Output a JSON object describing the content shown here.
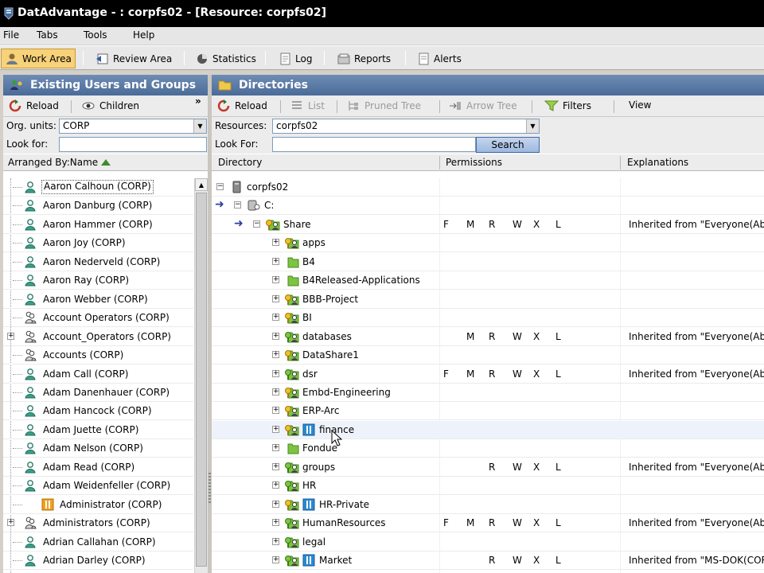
{
  "window": {
    "title": "DatAdvantage - : corpfs02 - [Resource: corpfs02]"
  },
  "menubar": {
    "items": [
      "File",
      "Tabs",
      "Tools",
      "Help"
    ]
  },
  "toolbar": {
    "work_area": "Work Area",
    "review_area": "Review Area",
    "statistics": "Statistics",
    "log": "Log",
    "reports": "Reports",
    "alerts": "Alerts"
  },
  "left": {
    "header": "Existing Users and Groups",
    "reload": "Reload",
    "children": "Children",
    "more": "»",
    "org_units_label": "Org. units:",
    "org_units_value": "CORP",
    "look_for_label": "Look for:",
    "look_for_value": "",
    "arranged_by": "Arranged By:Name",
    "users": [
      {
        "name": "Aaron Calhoun (CORP)",
        "type": "user",
        "expandable": false,
        "selected": true
      },
      {
        "name": "Aaron Danburg (CORP)",
        "type": "user",
        "expandable": false
      },
      {
        "name": "Aaron Hammer (CORP)",
        "type": "user",
        "expandable": false
      },
      {
        "name": "Aaron Joy (CORP)",
        "type": "user",
        "expandable": false
      },
      {
        "name": "Aaron Nederveld (CORP)",
        "type": "user",
        "expandable": false
      },
      {
        "name": "Aaron Ray (CORP)",
        "type": "user",
        "expandable": false
      },
      {
        "name": "Aaron Webber (CORP)",
        "type": "user",
        "expandable": false
      },
      {
        "name": "Account Operators (CORP)",
        "type": "group",
        "expandable": false
      },
      {
        "name": "Account_Operators (CORP)",
        "type": "group",
        "expandable": true
      },
      {
        "name": "Accounts (CORP)",
        "type": "group",
        "expandable": false
      },
      {
        "name": "Adam Call (CORP)",
        "type": "user",
        "expandable": false
      },
      {
        "name": "Adam Danenhauer (CORP)",
        "type": "user",
        "expandable": false
      },
      {
        "name": "Adam Hancock (CORP)",
        "type": "user",
        "expandable": false
      },
      {
        "name": "Adam Juette (CORP)",
        "type": "user",
        "expandable": false
      },
      {
        "name": "Adam Nelson (CORP)",
        "type": "user",
        "expandable": false
      },
      {
        "name": "Adam Read (CORP)",
        "type": "user",
        "expandable": false
      },
      {
        "name": "Adam Weidenfeller (CORP)",
        "type": "user",
        "expandable": false
      },
      {
        "name": "Administrator (CORP)",
        "type": "admin",
        "expandable": false
      },
      {
        "name": "Administrators (CORP)",
        "type": "group",
        "expandable": true
      },
      {
        "name": "Adrian Callahan (CORP)",
        "type": "user",
        "expandable": false
      },
      {
        "name": "Adrian Darley (CORP)",
        "type": "user",
        "expandable": false
      }
    ]
  },
  "right": {
    "header": "Directories",
    "reload": "Reload",
    "list": "List",
    "pruned_tree": "Pruned Tree",
    "arrow_tree": "Arrow Tree",
    "filters": "Filters",
    "view": "View",
    "resources_label": "Resources:",
    "resources_value": "corpfs02",
    "look_for_label": "Look For:",
    "look_for_value": "",
    "search_button": "Search",
    "columns": [
      "Directory",
      "Permissions",
      "Explanations"
    ],
    "rows": [
      {
        "name": "corpfs02",
        "level": 0,
        "icon": "server",
        "expander": "-",
        "perms": [],
        "expl": ""
      },
      {
        "name": "C:",
        "level": 1,
        "icon": "drive",
        "expander": "-",
        "arrow": true,
        "perms": [],
        "expl": ""
      },
      {
        "name": "Share",
        "level": 2,
        "icon": "share-folder",
        "expander": "-",
        "arrow": true,
        "perms": [
          "F",
          "M",
          "R",
          "W",
          "X",
          "L"
        ],
        "expl": "Inherited from \"Everyone(Abstr"
      },
      {
        "name": "apps",
        "level": 3,
        "icon": "folder-unique",
        "expander": "+",
        "perms": [],
        "expl": ""
      },
      {
        "name": "B4",
        "level": 3,
        "icon": "folder",
        "expander": "+",
        "perms": [],
        "expl": ""
      },
      {
        "name": "B4Released-Applications",
        "level": 3,
        "icon": "folder",
        "expander": "+",
        "perms": [],
        "expl": ""
      },
      {
        "name": "BBB-Project",
        "level": 3,
        "icon": "folder-unique",
        "expander": "+",
        "perms": [],
        "expl": ""
      },
      {
        "name": "BI",
        "level": 3,
        "icon": "folder-unique",
        "expander": "+",
        "perms": [],
        "expl": ""
      },
      {
        "name": "databases",
        "level": 3,
        "icon": "folder-perm",
        "expander": "+",
        "perms": [
          "",
          "M",
          "R",
          "W",
          "X",
          "L"
        ],
        "expl": "Inherited from \"Everyone(Abstr"
      },
      {
        "name": "DataShare1",
        "level": 3,
        "icon": "folder-unique",
        "expander": "+",
        "perms": [],
        "expl": ""
      },
      {
        "name": "dsr",
        "level": 3,
        "icon": "folder-perm",
        "expander": "+",
        "perms": [
          "F",
          "M",
          "R",
          "W",
          "X",
          "L"
        ],
        "expl": "Inherited from \"Everyone(Abstr"
      },
      {
        "name": "Embd-Engineering",
        "level": 3,
        "icon": "folder-unique",
        "expander": "+",
        "perms": [],
        "expl": ""
      },
      {
        "name": "ERP-Arc",
        "level": 3,
        "icon": "folder-unique",
        "expander": "+",
        "perms": [],
        "expl": ""
      },
      {
        "name": "finance",
        "level": 3,
        "icon": "folder-unique-tagged",
        "expander": "+",
        "perms": [],
        "expl": "",
        "hover": true
      },
      {
        "name": "Fondue",
        "level": 3,
        "icon": "folder",
        "expander": "+",
        "perms": [],
        "expl": ""
      },
      {
        "name": "groups",
        "level": 3,
        "icon": "folder-perm",
        "expander": "+",
        "perms": [
          "",
          "",
          "R",
          "W",
          "X",
          "L"
        ],
        "expl": "Inherited from \"Everyone(Abstr"
      },
      {
        "name": "HR",
        "level": 3,
        "icon": "folder-perm",
        "expander": "+",
        "perms": [],
        "expl": ""
      },
      {
        "name": "HR-Private",
        "level": 3,
        "icon": "folder-unique-tagged",
        "expander": "+",
        "perms": [],
        "expl": ""
      },
      {
        "name": "HumanResources",
        "level": 3,
        "icon": "folder-perm",
        "expander": "+",
        "perms": [
          "F",
          "M",
          "R",
          "W",
          "X",
          "L"
        ],
        "expl": "Inherited from \"Everyone(Abstr"
      },
      {
        "name": "legal",
        "level": 3,
        "icon": "folder-perm",
        "expander": "+",
        "perms": [],
        "expl": ""
      },
      {
        "name": "Market",
        "level": 3,
        "icon": "folder-perm-tagged",
        "expander": "+",
        "perms": [
          "",
          "",
          "R",
          "W",
          "X",
          "L"
        ],
        "expl": "Inherited from \"MS-DOK(CORP"
      }
    ]
  },
  "colors": {
    "panel_header": "#5a78a6",
    "active_tab": "#f7d27a",
    "folder_green": "#7cc442",
    "arrow_blue": "#2c3f9a"
  }
}
